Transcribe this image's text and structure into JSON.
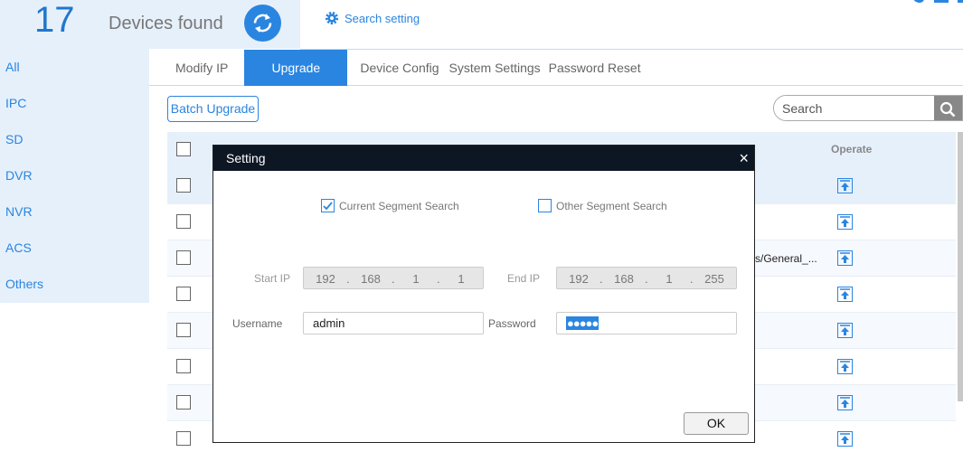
{
  "header": {
    "device_count": "17",
    "devices_found_label": "Devices found",
    "search_setting_label": "Search setting",
    "accent_color": "#2a85e0"
  },
  "sidebar": {
    "items": [
      {
        "label": "All"
      },
      {
        "label": "IPC"
      },
      {
        "label": "SD"
      },
      {
        "label": "DVR"
      },
      {
        "label": "NVR"
      },
      {
        "label": "ACS"
      },
      {
        "label": "Others"
      }
    ]
  },
  "tabs": [
    {
      "label": "Modify IP",
      "active": false
    },
    {
      "label": "Upgrade",
      "active": true
    },
    {
      "label": "Device Config",
      "active": false
    },
    {
      "label": "System Settings",
      "active": false
    },
    {
      "label": "Password Reset",
      "active": false
    }
  ],
  "toolbar": {
    "batch_upgrade_label": "Batch Upgrade",
    "search_placeholder": "Search"
  },
  "table": {
    "operate_header": "Operate",
    "row3_partial_text": "s/General_..."
  },
  "modal": {
    "title": "Setting",
    "close_label": "×",
    "current_segment_label": "Current Segment Search",
    "current_segment_checked": true,
    "other_segment_label": "Other Segment Search",
    "other_segment_checked": false,
    "start_ip_label": "Start IP",
    "start_ip": [
      "192",
      "168",
      "1",
      "1"
    ],
    "end_ip_label": "End IP",
    "end_ip": [
      "192",
      "168",
      "1",
      "255"
    ],
    "ip_separator": ".",
    "username_label": "Username",
    "username_value": "admin",
    "password_label": "Password",
    "password_mask": "●●●●●",
    "ok_label": "OK"
  }
}
